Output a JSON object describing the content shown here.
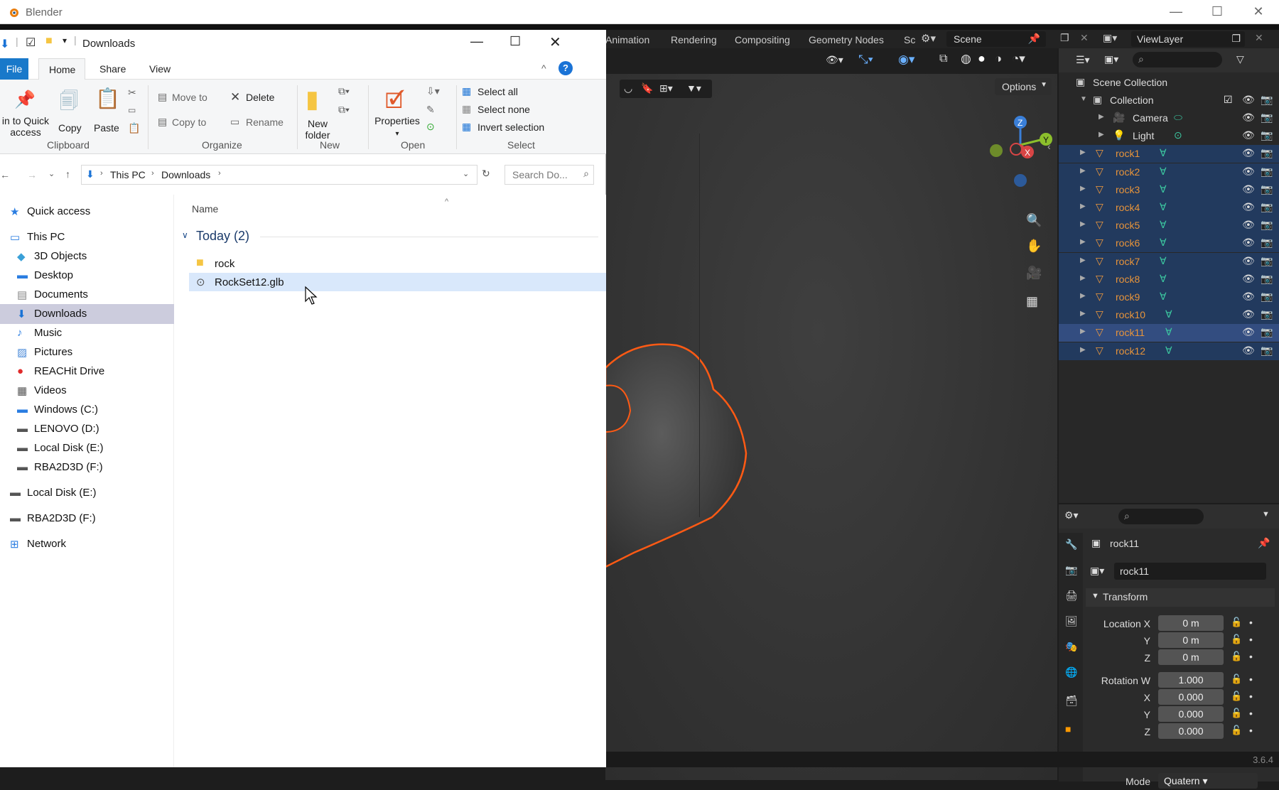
{
  "window": {
    "title": "Blender"
  },
  "explorer": {
    "path_label": "Downloads",
    "tabs": {
      "file": "File",
      "home": "Home",
      "share": "Share",
      "view": "View"
    },
    "ribbon": {
      "pin": "in to Quick access",
      "copy": "Copy",
      "paste": "Paste",
      "move_to": "Move to",
      "copy_to": "Copy to",
      "delete": "Delete",
      "rename": "Rename",
      "new_folder": "New folder",
      "properties": "Properties",
      "select_all": "Select all",
      "select_none": "Select none",
      "invert_selection": "Invert selection",
      "groups": {
        "clipboard": "Clipboard",
        "organize": "Organize",
        "new": "New",
        "open": "Open",
        "select": "Select"
      }
    },
    "address": {
      "this_pc": "This PC",
      "downloads": "Downloads",
      "search_placeholder": "Search Do..."
    },
    "nav": [
      {
        "label": "Quick access"
      },
      {
        "label": "This PC"
      },
      {
        "label": "3D Objects"
      },
      {
        "label": "Desktop"
      },
      {
        "label": "Documents"
      },
      {
        "label": "Downloads"
      },
      {
        "label": "Music"
      },
      {
        "label": "Pictures"
      },
      {
        "label": "REACHit Drive"
      },
      {
        "label": "Videos"
      },
      {
        "label": "Windows (C:)"
      },
      {
        "label": "LENOVO (D:)"
      },
      {
        "label": "Local Disk (E:)"
      },
      {
        "label": "RBA2D3D (F:)"
      },
      {
        "label": "Local Disk (E:)"
      },
      {
        "label": "RBA2D3D (F:)"
      },
      {
        "label": "Network"
      }
    ],
    "content": {
      "column_name": "Name",
      "group_label": "Today (2)",
      "files": [
        {
          "name": "rock"
        },
        {
          "name": "RockSet12.glb"
        }
      ]
    }
  },
  "blender": {
    "tabs": [
      "Animation",
      "Rendering",
      "Compositing",
      "Geometry Nodes",
      "Sc"
    ],
    "scene": "Scene",
    "view_layer": "ViewLayer",
    "options_label": "Options",
    "outliner": {
      "root": "Scene Collection",
      "collection": "Collection",
      "items": [
        "Camera",
        "Light",
        "rock1",
        "rock2",
        "rock3",
        "rock4",
        "rock5",
        "rock6",
        "rock7",
        "rock8",
        "rock9",
        "rock10",
        "rock11",
        "rock12"
      ]
    },
    "properties": {
      "object_name": "rock11",
      "data_name": "rock11",
      "panel": "Transform",
      "rows": [
        {
          "label": "Location X",
          "value": "0 m"
        },
        {
          "label": "Y",
          "value": "0 m"
        },
        {
          "label": "Z",
          "value": "0 m"
        },
        {
          "label": "Rotation W",
          "value": "1.000"
        },
        {
          "label": "X",
          "value": "0.000"
        },
        {
          "label": "Y",
          "value": "0.000"
        },
        {
          "label": "Z",
          "value": "0.000"
        }
      ],
      "mode_label": "Mode",
      "mode_value": "Quatern"
    },
    "version": "3.6.4",
    "gizmo": {
      "x": "X",
      "y": "Y",
      "z": "Z"
    }
  }
}
